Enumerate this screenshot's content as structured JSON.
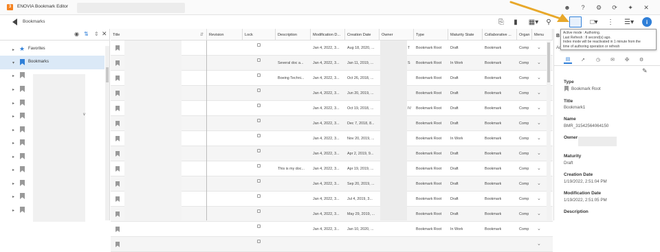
{
  "app": {
    "logo_glyph": "3",
    "title": "ENOVIA  Bookmark Editor",
    "title_icons": [
      "user-icon",
      "help-icon",
      "settings-icon",
      "refresh-icon",
      "pin-icon",
      "close-icon"
    ]
  },
  "toolbar": {
    "breadcrumb": "Bookmarks"
  },
  "tree": {
    "items": [
      {
        "label": "Favorites",
        "icon": "star-icon",
        "selected": false
      },
      {
        "label": "Bookmarks",
        "icon": "bookmark-icon",
        "selected": true
      },
      {
        "label": "",
        "icon": "bookmark-icon",
        "selected": false
      },
      {
        "label": "",
        "icon": "bookmark-icon",
        "selected": false
      },
      {
        "label": "",
        "icon": "bookmark-icon",
        "selected": false
      },
      {
        "label": "",
        "icon": "bookmark-icon",
        "selected": false
      },
      {
        "label": "",
        "icon": "bookmark-icon",
        "selected": false
      },
      {
        "label": "",
        "icon": "bookmark-icon",
        "selected": false
      },
      {
        "label": "",
        "icon": "bookmark-icon",
        "selected": false
      },
      {
        "label": "",
        "icon": "bookmark-icon",
        "selected": false
      },
      {
        "label": "",
        "icon": "bookmark-icon",
        "selected": false
      },
      {
        "label": "",
        "icon": "bookmark-icon",
        "selected": false
      },
      {
        "label": "",
        "icon": "bookmark-icon",
        "selected": false
      }
    ],
    "partial_text": "v"
  },
  "grid": {
    "columns": [
      "Title",
      "Revision",
      "Lock",
      "Description",
      "Modification D...",
      "Creation Date",
      "Owner",
      "Type",
      "Maturity State",
      "Collaborative ...",
      "Organ",
      "Menu"
    ],
    "rows": [
      {
        "desc": "",
        "mod": "Jan 4, 2022, 3...",
        "created": "Aug 18, 2020, ...",
        "owner_tail": "T",
        "type": "Bookmark Root",
        "maturity": "Draft",
        "collab": "Bookmark",
        "org": "Comp"
      },
      {
        "desc": "Several doc a...",
        "mod": "Jan 4, 2022, 3...",
        "created": "Jan 11, 2019, ...",
        "owner_tail": "S",
        "type": "Bookmark Root",
        "maturity": "In Work",
        "collab": "Bookmark",
        "org": "Comp"
      },
      {
        "desc": "Boeing Techni...",
        "mod": "Jan 4, 2022, 3...",
        "created": "Oct 26, 2018, ...",
        "owner_tail": "",
        "type": "Bookmark Root",
        "maturity": "Draft",
        "collab": "Bookmark",
        "org": "Comp"
      },
      {
        "desc": "",
        "mod": "Jan 4, 2022, 3...",
        "created": "Jun 20, 2019, ...",
        "owner_tail": "",
        "type": "Bookmark Root",
        "maturity": "Draft",
        "collab": "Bookmark",
        "org": "Comp"
      },
      {
        "desc": "",
        "mod": "Jan 4, 2022, 3...",
        "created": "Oct 19, 2018, ...",
        "owner_tail": "IV",
        "type": "Bookmark Root",
        "maturity": "Draft",
        "collab": "Bookmark",
        "org": "Comp"
      },
      {
        "desc": "",
        "mod": "Jan 4, 2022, 3...",
        "created": "Dec 7, 2018, 8...",
        "owner_tail": "",
        "type": "Bookmark Root",
        "maturity": "Draft",
        "collab": "Bookmark",
        "org": "Comp"
      },
      {
        "desc": "",
        "mod": "Jan 4, 2022, 3...",
        "created": "Nov 20, 2019, ...",
        "owner_tail": "",
        "type": "Bookmark Root",
        "maturity": "In Work",
        "collab": "Bookmark",
        "org": "Comp"
      },
      {
        "desc": "",
        "mod": "Jan 4, 2022, 3...",
        "created": "Apr 2, 2019, 9...",
        "owner_tail": "",
        "type": "Bookmark Root",
        "maturity": "Draft",
        "collab": "Bookmark",
        "org": "Comp"
      },
      {
        "desc": "This is my doc...",
        "mod": "Jan 4, 2022, 3...",
        "created": "Apr 19, 2019, ...",
        "owner_tail": "",
        "type": "Bookmark Root",
        "maturity": "Draft",
        "collab": "Bookmark",
        "org": "Comp"
      },
      {
        "desc": "",
        "mod": "Jan 4, 2022, 3...",
        "created": "Sep 20, 2019, ...",
        "owner_tail": "",
        "type": "Bookmark Root",
        "maturity": "Draft",
        "collab": "Bookmark",
        "org": "Comp"
      },
      {
        "desc": "",
        "mod": "Jan 4, 2022, 3...",
        "created": "Jul 4, 2019, 3...",
        "owner_tail": "",
        "type": "Bookmark Root",
        "maturity": "Draft",
        "collab": "Bookmark",
        "org": "Comp"
      },
      {
        "desc": "",
        "mod": "Jan 4, 2022, 3...",
        "created": "May 29, 2019, ...",
        "owner_tail": "",
        "type": "Bookmark Root",
        "maturity": "Draft",
        "collab": "Bookmark",
        "org": "Comp"
      },
      {
        "desc": "",
        "mod": "Jan 4, 2022, 3...",
        "created": "Jan 10, 2020, ...",
        "owner_tail": "",
        "type": "Bookmark Root",
        "maturity": "In Work",
        "collab": "Bookmark",
        "org": "Comp"
      },
      {
        "desc": "",
        "mod": "",
        "created": "",
        "owner_tail": "",
        "type": "",
        "maturity": "",
        "collab": "",
        "org": ""
      }
    ]
  },
  "tooltip": {
    "line1": "Active mode : Authoring.",
    "line2": "Last Refresh : 8 second(s) ago.",
    "line3": "Index mode will be reactivated in 1 minute from the",
    "line4": "time of authoring operation or refresh"
  },
  "panel": {
    "clipped_left": "B",
    "clipped_left2": "Ad",
    "type_label": "Type",
    "type_value": "Bookmark Root",
    "title_label": "Title",
    "title_value": "Bookmark1",
    "name_label": "Name",
    "name_value": "BMR_31542564064150",
    "owner_label": "Owner",
    "maturity_label": "Maturity",
    "maturity_value": "Draft",
    "creation_label": "Creation Date",
    "creation_value": "1/19/2022, 2:51:04 PM",
    "modification_label": "Modification Date",
    "modification_value": "1/19/2022, 2:51:05 PM",
    "description_label": "Description"
  },
  "colors": {
    "accent_blue": "#2f7fd8",
    "arrow": "#e8a82a",
    "logo": "#f58220"
  }
}
